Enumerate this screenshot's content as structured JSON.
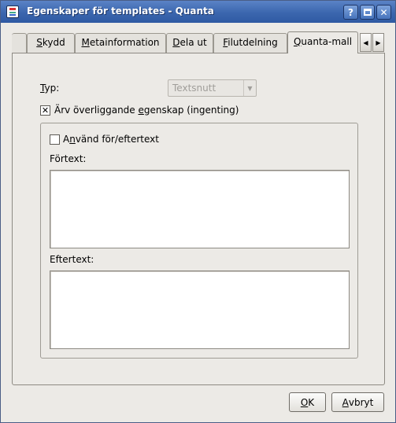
{
  "window": {
    "title": "Egenskaper för templates - Quanta",
    "buttons": {
      "help": "?",
      "close": "✕"
    }
  },
  "tabs": [
    {
      "label_first": "S",
      "label_rest": "kydd"
    },
    {
      "label_first": "M",
      "label_rest": "etainformation"
    },
    {
      "label_first": "D",
      "label_rest": "ela ut"
    },
    {
      "label_first": "F",
      "label_rest": "ilutdelning"
    },
    {
      "label_first": "Q",
      "label_rest": "uanta-mall",
      "active": true
    }
  ],
  "tab_scroll": {
    "left": "◀",
    "right": "▶"
  },
  "form": {
    "type_label_first": "T",
    "type_label_rest": "yp:",
    "type_value": "Textsnutt",
    "inherit_checked": true,
    "inherit_label_pre": "Ärv överliggande ",
    "inherit_label_u": "e",
    "inherit_label_post": "genskap (ingenting)",
    "use_pre_post_checked": false,
    "use_pre_post_pre": "A",
    "use_pre_post_u": "n",
    "use_pre_post_post": "vänd för/eftertext",
    "pretext_label": "Förtext:",
    "posttext_label": "Eftertext:",
    "pretext_value": "",
    "posttext_value": ""
  },
  "footer": {
    "ok_first": "O",
    "ok_rest": "K",
    "cancel_first": "A",
    "cancel_rest": "vbryt"
  },
  "glyphs": {
    "check": "✕",
    "dropdown": "▼"
  }
}
